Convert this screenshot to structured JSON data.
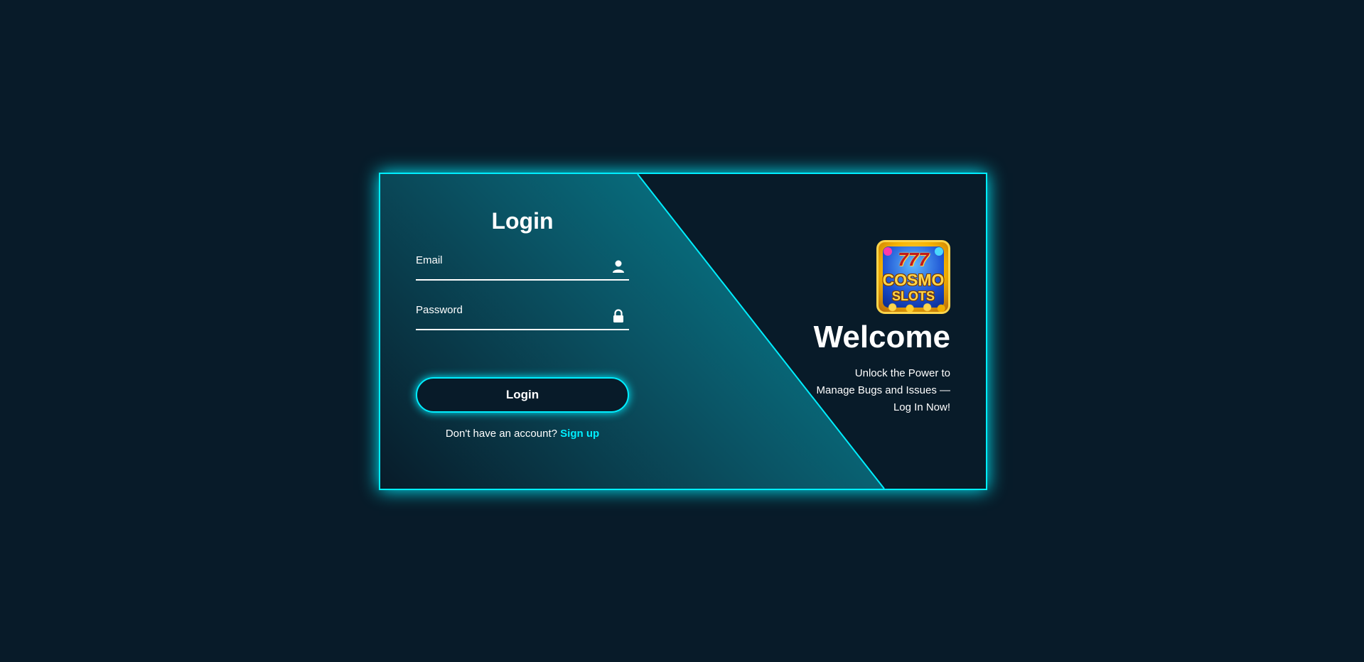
{
  "login_form": {
    "title": "Login",
    "email_label": "Email",
    "password_label": "Password",
    "submit_label": "Login",
    "signup_prompt": "Don't have an account?",
    "signup_link": "Sign up"
  },
  "info_panel": {
    "logo_line1": "777",
    "logo_line2": "COSMO",
    "logo_line3": "SLOTS",
    "title": "Welcome",
    "text": "Unlock the Power to Manage Bugs and Issues —Log In Now!"
  },
  "icons": {
    "email": "user-icon",
    "password": "lock-icon"
  },
  "colors": {
    "background": "#081b29",
    "accent": "#00eeff",
    "text": "#ffffff"
  }
}
